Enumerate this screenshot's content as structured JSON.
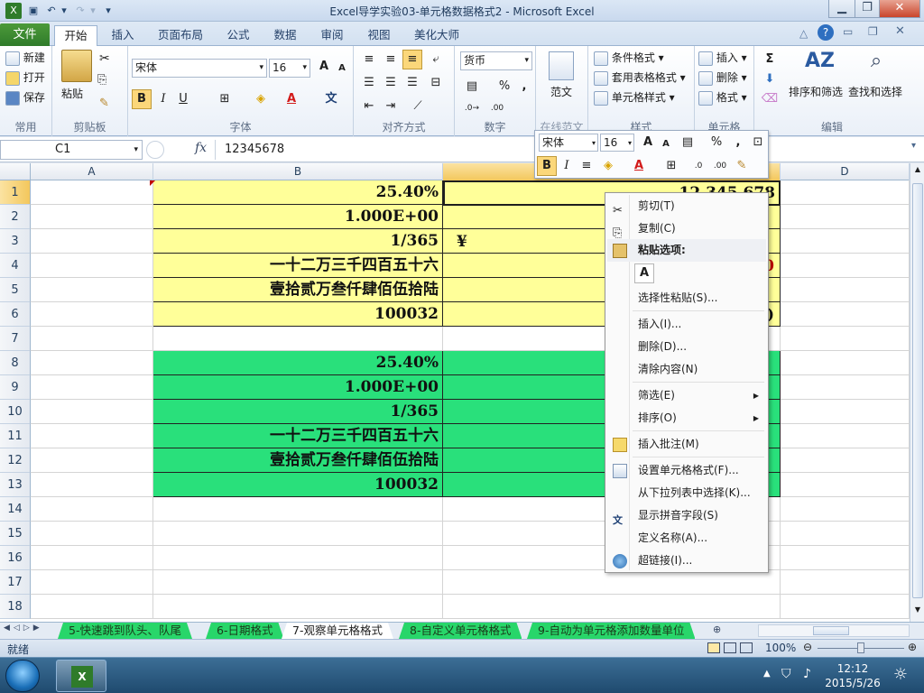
{
  "window": {
    "title": "Excel导学实验03-单元格数据格式2  -  Microsoft Excel"
  },
  "tabs": {
    "file": "文件",
    "home": "开始",
    "insert": "插入",
    "layout": "页面布局",
    "formulas": "公式",
    "data": "数据",
    "review": "审阅",
    "view": "视图",
    "beautify": "美化大师"
  },
  "ribbon": {
    "clipboard": {
      "label": "常用",
      "new": "新建",
      "open": "打开",
      "save": "保存"
    },
    "paste": {
      "label": "剪贴板",
      "paste": "粘贴"
    },
    "font": {
      "label": "字体",
      "name": "宋体",
      "size": "16",
      "bold": "B",
      "italic": "I",
      "underline": "U",
      "grow": "A",
      "shrink": "A",
      "fontcolor": "A",
      "phonetic": "文"
    },
    "align": {
      "label": "对齐方式"
    },
    "number": {
      "label": "数字",
      "format": "货币",
      "percent": "%",
      "comma": ","
    },
    "convert": {
      "label": "范",
      "text": "范文"
    },
    "styles": {
      "label": "样式",
      "cond": "条件格式",
      "table": "套用表格格式",
      "cellstyle": "单元格样式"
    },
    "cells": {
      "label": "单元格",
      "insert": "插入",
      "delete": "删除",
      "format": "格式"
    },
    "edit": {
      "label": "编辑",
      "sigma": "Σ",
      "sort": "排序和筛选",
      "find": "查找和选择"
    },
    "hidden_label": "在线范文"
  },
  "formula": {
    "namebox": "C1",
    "fx": "fx",
    "value": "12345678"
  },
  "columns": [
    "A",
    "B",
    "C",
    "D"
  ],
  "rows": [
    "1",
    "2",
    "3",
    "4",
    "5",
    "6",
    "7",
    "8",
    "9",
    "10",
    "11",
    "12",
    "13",
    "14",
    "15",
    "16",
    "17",
    "18"
  ],
  "cells_b": [
    "25.40%",
    "1.000E+00",
    "1/365",
    "一十二万三千四百五十六",
    "壹拾贰万叁仟肆佰伍拾陆",
    "100032",
    "",
    "25.40%",
    "1.000E+00",
    "1/365",
    "一十二万三千四百五十六",
    "壹拾贰万叁仟肆佰伍拾陆",
    "100032"
  ],
  "cells_c": {
    "c1": "12,345,678",
    "c3": "¥",
    "c4": "0",
    "c6": ")"
  },
  "colors": {
    "yellow": "#ffff99",
    "green": "#29e07b",
    "selected_header": "#f9d27a",
    "accent": "#2f7b2a"
  },
  "mini_toolbar": {
    "font": "宋体",
    "size": "16",
    "percent": "%",
    "comma": ","
  },
  "context_menu": {
    "cut": "剪切(T)",
    "copy": "复制(C)",
    "paste_header": "粘贴选项:",
    "paste_a": "A",
    "paste_special": "选择性粘贴(S)...",
    "insert": "插入(I)...",
    "delete": "删除(D)...",
    "clear": "清除内容(N)",
    "filter": "筛选(E)",
    "sort": "排序(O)",
    "comment": "插入批注(M)",
    "format": "设置单元格格式(F)...",
    "dropdown": "从下拉列表中选择(K)...",
    "phonetic": "显示拼音字段(S)",
    "define": "定义名称(A)...",
    "hyperlink": "超链接(I)..."
  },
  "sheets": [
    "5-快速跳到队头、队尾",
    "6-日期格式",
    "7-观察单元格格式",
    "8-自定义单元格格式",
    "9-自动为单元格添加数量单位"
  ],
  "status": {
    "ready": "就绪",
    "zoom": "100%"
  },
  "taskbar": {
    "time": "12:12",
    "date": "2015/5/26"
  }
}
